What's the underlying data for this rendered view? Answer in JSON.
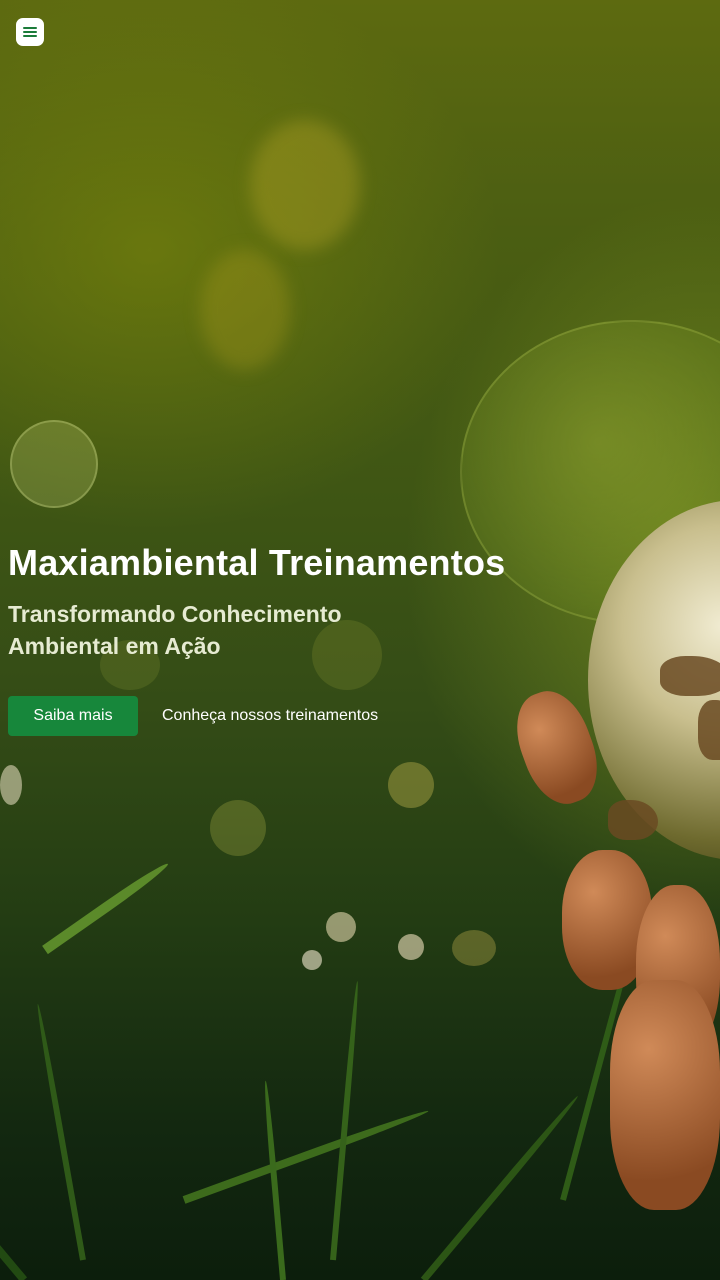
{
  "header": {
    "menu_icon": "hamburger-menu-icon",
    "menu_button_color": "#ffffff",
    "menu_icon_color": "#1b7b3a"
  },
  "hero": {
    "background": "grass-and-globe-photo",
    "title": "Maxiambiental Treinamentos",
    "subtitle": "Transformando Conhecimento Ambiental em Ação",
    "primary_button_label": "Saiba mais",
    "secondary_link_label": "Conheça nossos treinamentos",
    "accent_color": "#17873b"
  }
}
